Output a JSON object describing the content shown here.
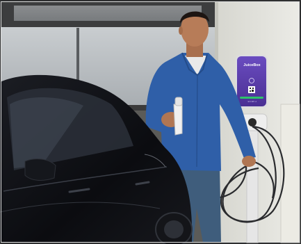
{
  "photo": {
    "subject": "man-plugging-in-electric-car",
    "charger": {
      "brand": "JuiceBox",
      "footer_code": "EN-WP-A",
      "colors": {
        "panel": "#5a3fa8",
        "status_bar": "#2ec36a",
        "housing": "#e9e9ec"
      }
    },
    "colors": {
      "wall": "#dcdcd6",
      "window_frame": "#3b3b3b",
      "car": "#0d0e12",
      "shirt": "#2f5fa8",
      "jeans": "#3f5d7c"
    }
  }
}
